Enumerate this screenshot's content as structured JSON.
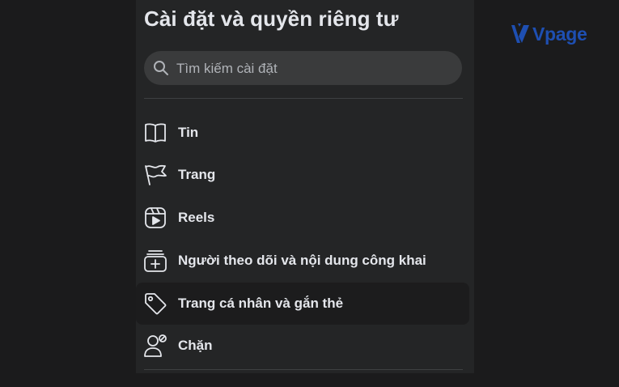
{
  "settings": {
    "title": "Cài đặt và quyền riêng tư",
    "search": {
      "placeholder": "Tìm kiếm cài đặt",
      "icon": "search-icon"
    },
    "items": [
      {
        "label": "Tin",
        "icon": "book-icon"
      },
      {
        "label": "Trang",
        "icon": "flag-icon"
      },
      {
        "label": "Reels",
        "icon": "reels-icon"
      },
      {
        "label": "Người theo dõi và nội dung công khai",
        "icon": "followers-icon"
      },
      {
        "label": "Trang cá nhân và gắn thẻ",
        "icon": "tag-icon",
        "hovered": true
      },
      {
        "label": "Chặn",
        "icon": "block-user-icon"
      }
    ]
  },
  "brand": {
    "name": "Vpage",
    "color": "#1e4fb2"
  },
  "colors": {
    "panel": "#242526",
    "text": "#e4e6eb",
    "page": "#1b1b1c"
  }
}
